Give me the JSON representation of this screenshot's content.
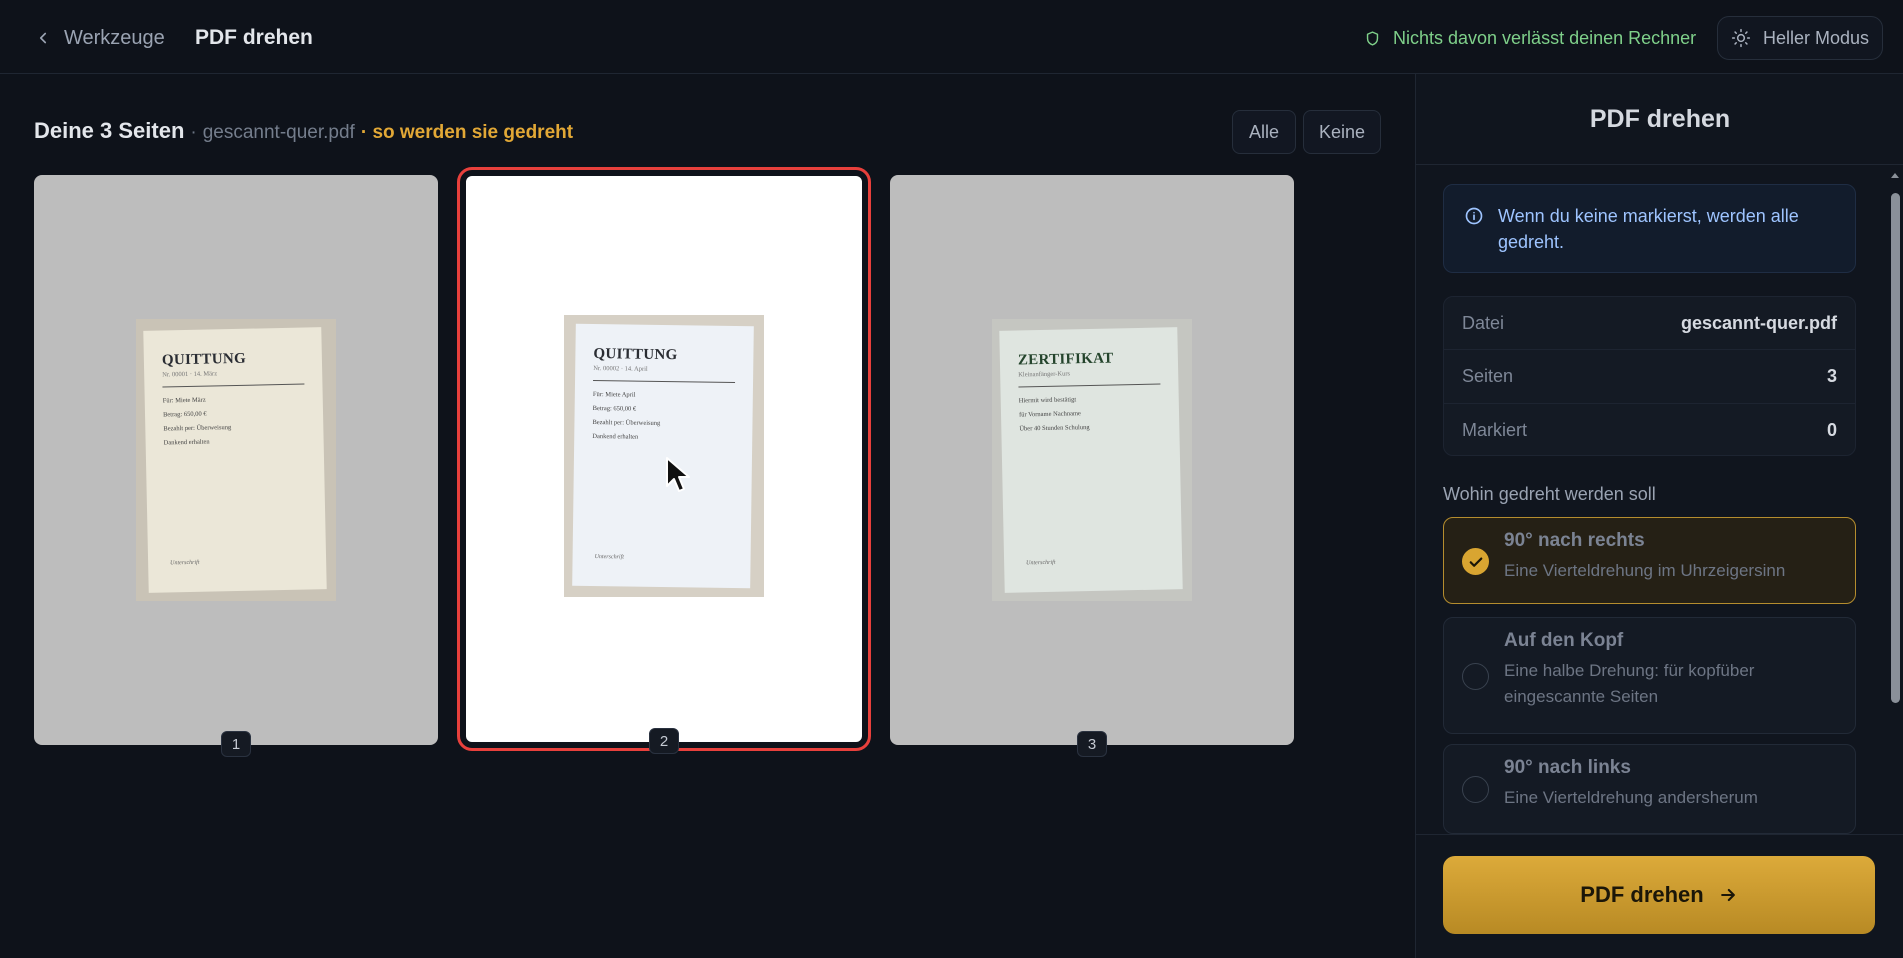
{
  "header": {
    "back_label": "Werkzeuge",
    "title": "PDF drehen",
    "privacy_note": "Nichts davon verlässt deinen Rechner",
    "mode_toggle": "Heller Modus"
  },
  "pages": {
    "count_label": "Deine 3 Seiten",
    "separator": "·",
    "filename": "gescannt-quer.pdf",
    "hint": "· so werden sie gedreht",
    "select_all": "Alle",
    "select_none": "Keine",
    "items": [
      {
        "number": "1",
        "title": "QUITTUNG",
        "subtitle": "Nr. 00001 · 14. März",
        "lines": [
          "Für: Miete März",
          "Betrag: 650,00 €",
          "Bezahlt per: Überweisung",
          "Dankend erhalten"
        ],
        "signature": "Unterschrift",
        "paper_color": "#ebe7d8",
        "selected": false
      },
      {
        "number": "2",
        "title": "QUITTUNG",
        "subtitle": "Nr. 00002 · 14. April",
        "lines": [
          "Für: Miete April",
          "Betrag: 650,00 €",
          "Bezahlt per: Überweisung",
          "Dankend erhalten"
        ],
        "signature": "Unterschrift",
        "paper_color": "#eef2f7",
        "selected": true
      },
      {
        "number": "3",
        "title": "ZERTIFIKAT",
        "subtitle": "Kleinanfänger-Kurs",
        "lines": [
          "Hiermit wird bestätigt",
          "für Vorname Nachname",
          "Über 40 Stunden Schulung"
        ],
        "signature": "Unterschrift",
        "paper_color": "#dfe5e0",
        "selected": false
      }
    ]
  },
  "panel": {
    "title": "PDF drehen",
    "info": "Wenn du keine markierst, werden alle gedreht.",
    "facts": [
      {
        "key": "Datei",
        "value": "gescannt-quer.pdf"
      },
      {
        "key": "Seiten",
        "value": "3"
      },
      {
        "key": "Markiert",
        "value": "0"
      }
    ],
    "direction_label": "Wohin gedreht werden soll",
    "options": [
      {
        "title": "90° nach rechts",
        "desc": "Eine Vierteldrehung im Uhrzeigersinn",
        "active": true
      },
      {
        "title": "Auf den Kopf",
        "desc": "Eine halbe Drehung: für kopfüber eingescannte Seiten",
        "active": false
      },
      {
        "title": "90° nach links",
        "desc": "Eine Vierteldrehung andersherum",
        "active": false
      }
    ],
    "cta": "PDF drehen"
  },
  "colors": {
    "accent": "#d9a531",
    "selection": "#e8403c",
    "privacy": "#7fd08a",
    "info": "#9ec4ff"
  }
}
